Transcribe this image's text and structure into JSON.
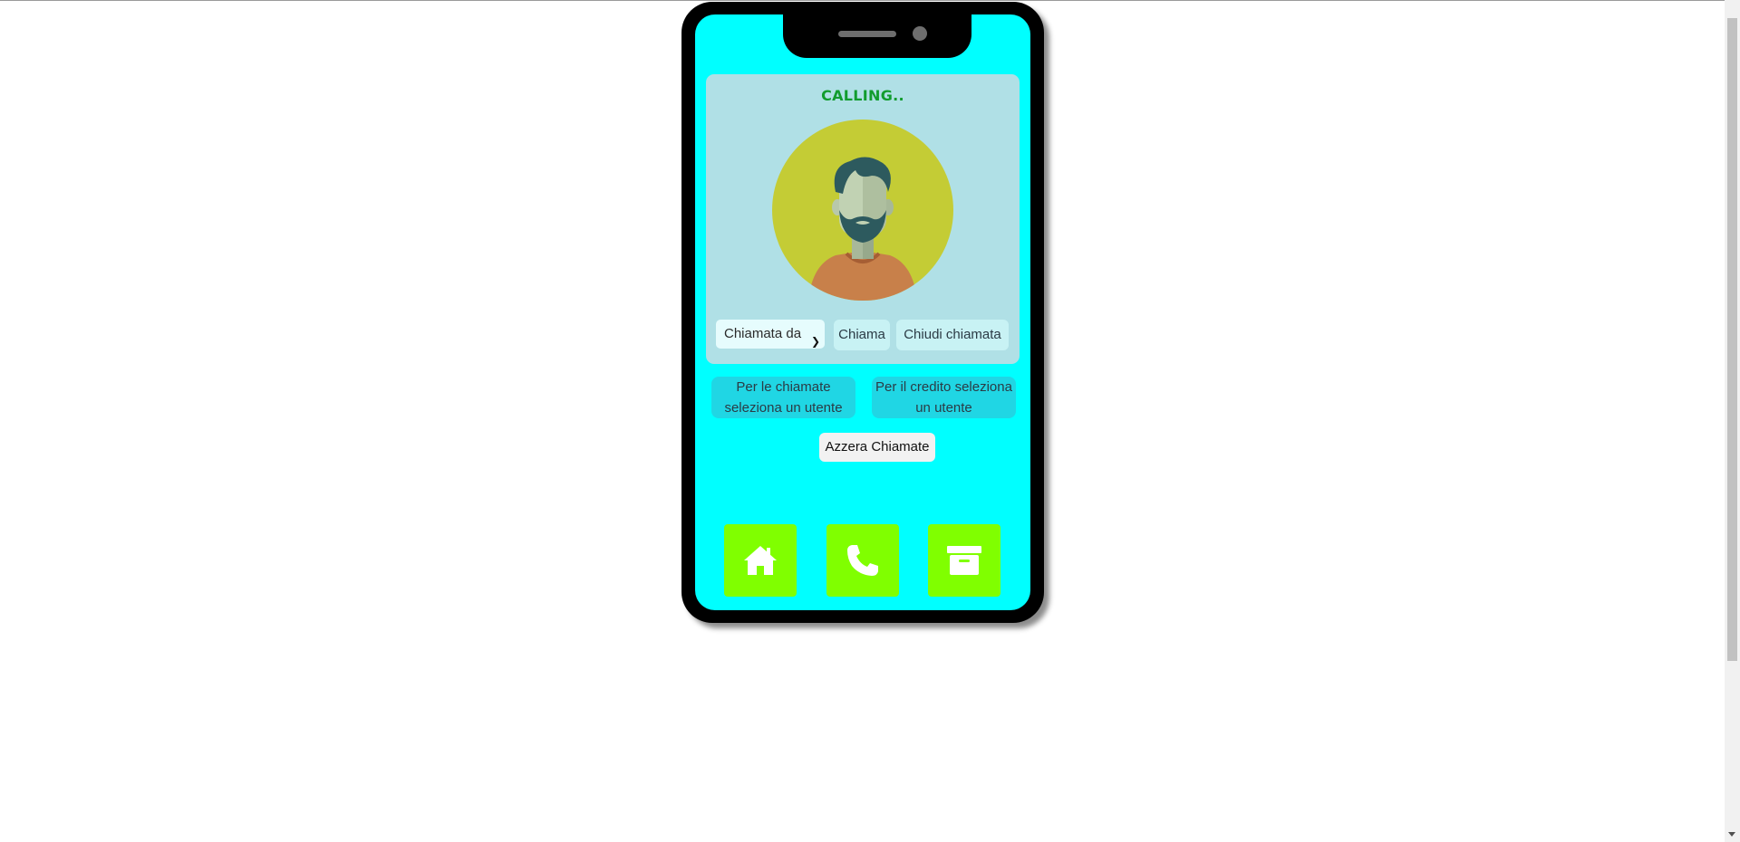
{
  "call": {
    "status": "CALLING.."
  },
  "controls": {
    "select_value": "Chiamata da",
    "call_button": "Chiama",
    "hangup_button": "Chiudi chiamata"
  },
  "info": {
    "calls_text": "Per le chiamate seleziona un utente",
    "credit_text": "Per il credito seleziona un utente"
  },
  "reset_button": "Azzera Chiamate",
  "nav": {
    "items": [
      {
        "icon": "home-icon"
      },
      {
        "icon": "phone-icon"
      },
      {
        "icon": "archive-icon"
      }
    ]
  },
  "colors": {
    "screen_bg": "#00ffff",
    "card_bg": "#b0e0e6",
    "status_color": "#129c2e",
    "nav_bg": "#80ff00",
    "info_bg": "#20d6e4"
  }
}
